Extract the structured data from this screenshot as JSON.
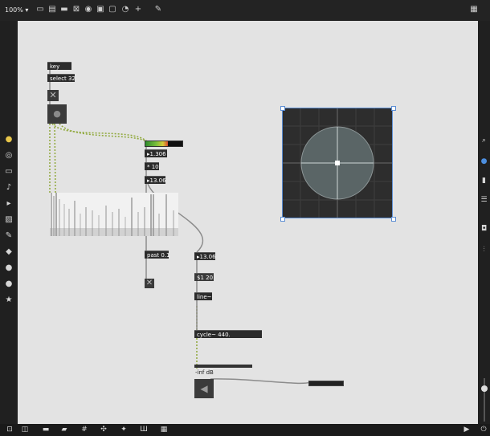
{
  "toolbar": {
    "zoom_label": "100%",
    "icons": [
      "presentation-icon",
      "patcher-window-icon",
      "comment-icon",
      "message-icon",
      "button-icon",
      "toggle-icon",
      "number-icon",
      "dial-icon",
      "add-object-icon",
      "edit-icon"
    ],
    "grid_icon": "grid-icon"
  },
  "objects": {
    "key": "key",
    "select": "select 32",
    "num_1306": "1.306",
    "times10": "* 10.",
    "num_1306b": "13.06",
    "past": "past 0.1",
    "num_1306c": "13.06",
    "msg_120": "$1 20",
    "line": "line~",
    "cycle": "cycle~ 440.",
    "gain_label": "-inf dB"
  },
  "left_sidebar": [
    "recent-icon",
    "browser-icon",
    "objects-icon",
    "music-icon",
    "media-icon",
    "image-icon",
    "snippets-icon",
    "packages-icon",
    "patreon-icon",
    "help-icon",
    "favorites-icon"
  ],
  "right_sidebar": [
    "search-icon",
    "info-icon",
    "inspector-icon",
    "list-icon",
    "camera-icon",
    "mixer-icon"
  ],
  "bottom_bar": [
    "lock-icon",
    "presentation-mode-icon",
    "comment-icon",
    "layers-icon",
    "grid-icon",
    "snap-icon",
    "wrench-icon",
    "columns-icon",
    "keyboard-icon"
  ],
  "colors": {
    "canvas": "#e3e3e3",
    "object": "#2b2b2b",
    "patchcord": "#8fa83a",
    "selection": "#5c8ed4"
  }
}
